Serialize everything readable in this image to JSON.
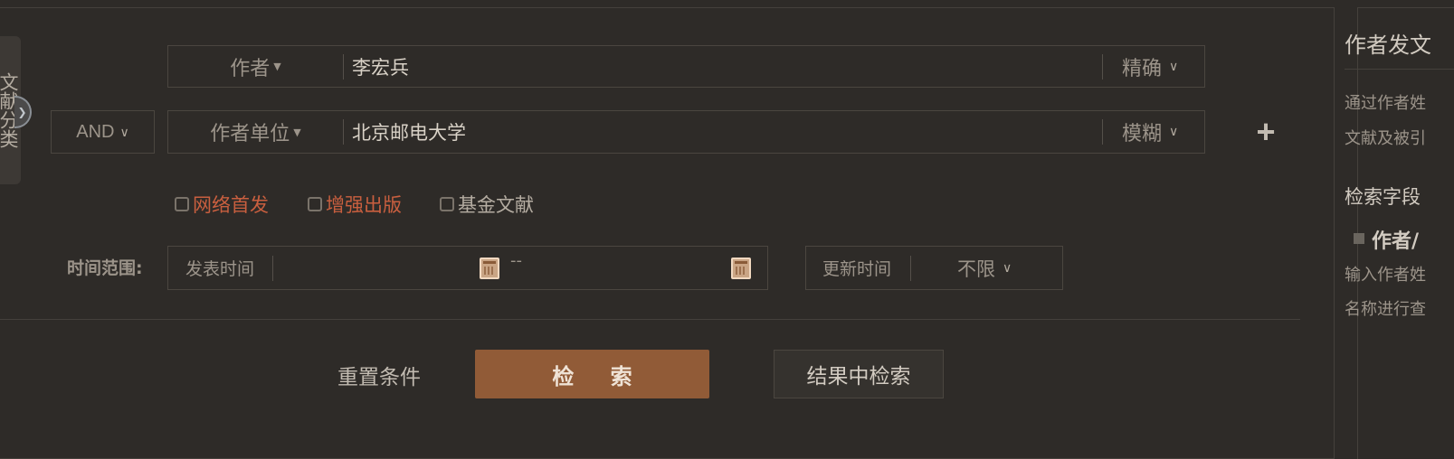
{
  "side_tab": {
    "label": "文献分类",
    "handle_icon": "chevron-right-icon"
  },
  "rows": [
    {
      "field": "作者",
      "value": "李宏兵",
      "match": "精确"
    },
    {
      "field": "作者单位",
      "value": "北京邮电大学",
      "match": "模糊",
      "logic": "AND"
    }
  ],
  "checkboxes": [
    {
      "label": "网络首发",
      "checked": false,
      "color": "#c95f3f"
    },
    {
      "label": "增强出版",
      "checked": false,
      "color": "#c95f3f"
    },
    {
      "label": "基金文献",
      "checked": false,
      "color": "#b5ada2"
    }
  ],
  "time": {
    "label": "时间范围:",
    "publish_label": "发表时间",
    "separator": "--",
    "update_label": "更新时间",
    "update_value": "不限"
  },
  "actions": {
    "reset": "重置条件",
    "search": "检 索",
    "search_in_results": "结果中检索"
  },
  "right_panel": {
    "title": "作者发文",
    "line1": "通过作者姓",
    "line2": "文献及被引",
    "subtitle": "检索字段",
    "item": "作者/",
    "line3": "输入作者姓",
    "line4": "名称进行查"
  },
  "colors": {
    "accent": "#915b37",
    "background": "#2e2b28",
    "highlight_text": "#c95f3f"
  }
}
